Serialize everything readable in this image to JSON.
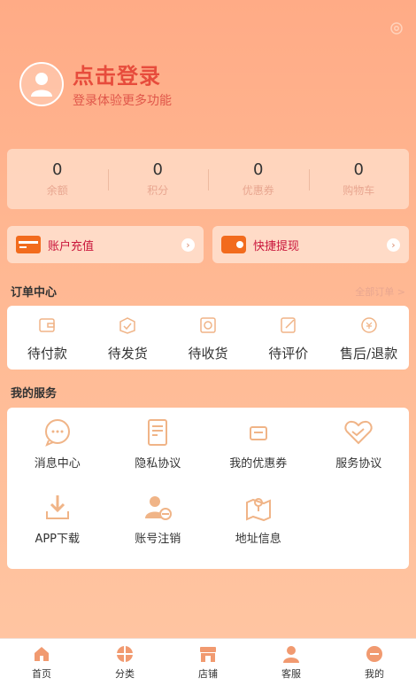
{
  "colors": {
    "accent": "#f26b1d",
    "icon": "#f0b487",
    "title": "#e74c3c",
    "tabIcon": "#f19a70"
  },
  "profile": {
    "title": "点击登录",
    "subtitle": "登录体验更多功能"
  },
  "stats": [
    {
      "value": "0",
      "label": "余额"
    },
    {
      "value": "0",
      "label": "积分"
    },
    {
      "value": "0",
      "label": "优惠券"
    },
    {
      "value": "0",
      "label": "购物车"
    }
  ],
  "quick": {
    "recharge": "账户充值",
    "withdraw": "快捷提现"
  },
  "orders": {
    "title": "订单中心",
    "all_link": "全部订单 >",
    "items": [
      "待付款",
      "待发货",
      "待收货",
      "待评价",
      "售后/退款"
    ]
  },
  "services": {
    "title": "我的服务",
    "items": [
      "消息中心",
      "隐私协议",
      "我的优惠券",
      "服务协议",
      "APP下载",
      "账号注销",
      "地址信息"
    ]
  },
  "tabs": [
    "首页",
    "分类",
    "店铺",
    "客服",
    "我的"
  ]
}
